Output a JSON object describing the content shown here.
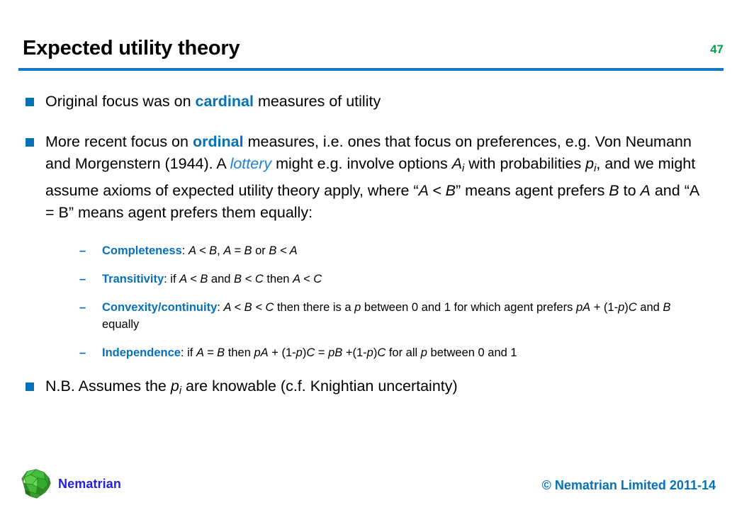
{
  "slide": {
    "title": "Expected utility theory",
    "page_number": "47",
    "accent_color": "#0571b8",
    "rule_color": "#1878c8",
    "page_number_color": "#00a04b"
  },
  "bullets": [
    {
      "marker": "square-bullet",
      "plain_text": "Original focus was on cardinal measures of utility",
      "parts": {
        "pre": "Original focus was on ",
        "keyword": "cardinal",
        "post": " measures of utility"
      }
    },
    {
      "marker": "square-bullet",
      "plain_text": "More recent focus on ordinal measures, i.e. ones that focus on preferences, e.g. Von Neumann and Morgenstern (1944). A lottery might e.g. involve options Ai with probabilities pi, and we might assume axioms of expected utility theory apply, where “A < B” means agent prefers B to A and “A = B” means agent prefers them equally:",
      "parts": {
        "s1": "More recent focus on ",
        "keyword": "ordinal",
        "s2": " measures, i.e. ones that focus on preferences, e.g. Von Neumann and Morgenstern (1944). A ",
        "emphasis": "lottery",
        "s3": " might e.g. involve options ",
        "var_A": "A",
        "sub_i_1": "i",
        "s4": " with probabilities ",
        "var_p": "p",
        "sub_i_2": "i",
        "s5": ", and we might assume axioms of expected utility theory apply, where “",
        "expr_a": "A < B",
        "s6": "” means agent prefers ",
        "var_B": "B",
        "s7": " to ",
        "var_A2": "A",
        "s8": " and “A = B” means agent prefers them equally:"
      }
    }
  ],
  "axioms": [
    {
      "marker": "dash",
      "name": "Completeness",
      "colon": ": ",
      "plain_text": "Completeness: A < B, A = B or B < A",
      "statement_parts": {
        "e1": "A < B",
        "t1": ", ",
        "e2": "A = B",
        "t2": " or ",
        "e3": "B < A"
      }
    },
    {
      "marker": "dash",
      "name": "Transitivity",
      "colon": ": ",
      "plain_text": "Transitivity:  if A < B and B < C then A < C",
      "statement_parts": {
        "t0": " if ",
        "e1": "A < B",
        "t1": " and ",
        "e2": "B < C",
        "t2": " then ",
        "e3": "A < C"
      }
    },
    {
      "marker": "dash",
      "name": "Convexity/continuity",
      "colon": ": ",
      "plain_text": "Convexity/continuity:  A < B < C then there is a p between 0 and 1 for which agent prefers pA + (1-p)C and B equally",
      "statement_parts": {
        "t0": "  ",
        "e1": "A < B < C",
        "t1": " then there is a ",
        "e2": "p",
        "t2": " between 0 and 1 for which agent prefers ",
        "e3": "pA",
        "t3": " + (1-",
        "e4": "p",
        "t4": ")",
        "e5": "C",
        "t5": " and ",
        "e6": "B",
        "t6": " equally"
      }
    },
    {
      "marker": "dash",
      "name": "Independence",
      "colon": ": ",
      "plain_text": "Independence: if A = B then pA + (1-p)C = pB +(1-p)C for all p between 0 and 1",
      "statement_parts": {
        "t0": "if ",
        "e1": "A = B",
        "t1": " then ",
        "e2": "pA",
        "t2": " + (1-",
        "e3": "p",
        "t3": ")",
        "e4": "C",
        "t4": " = ",
        "e5": "pB",
        "t5": " +(1-",
        "e6": "p",
        "t6": ")",
        "e7": "C",
        "t7": " for all ",
        "e8": "p",
        "t8": " between 0 and 1"
      }
    }
  ],
  "closing_bullet": {
    "marker": "square-bullet",
    "plain_text": "N.B. Assumes the pi are knowable (c.f. Knightian uncertainty)",
    "parts": {
      "pre": "N.B. Assumes the ",
      "var_p": "p",
      "sub_i": "i",
      "post": " are knowable (c.f. Knightian uncertainty)"
    }
  },
  "footer": {
    "logo_label": "Nematrian",
    "logo_text_color": "#2222dd",
    "copyright": "© Nematrian Limited 2011-14",
    "copyright_color": "#0571b8"
  }
}
